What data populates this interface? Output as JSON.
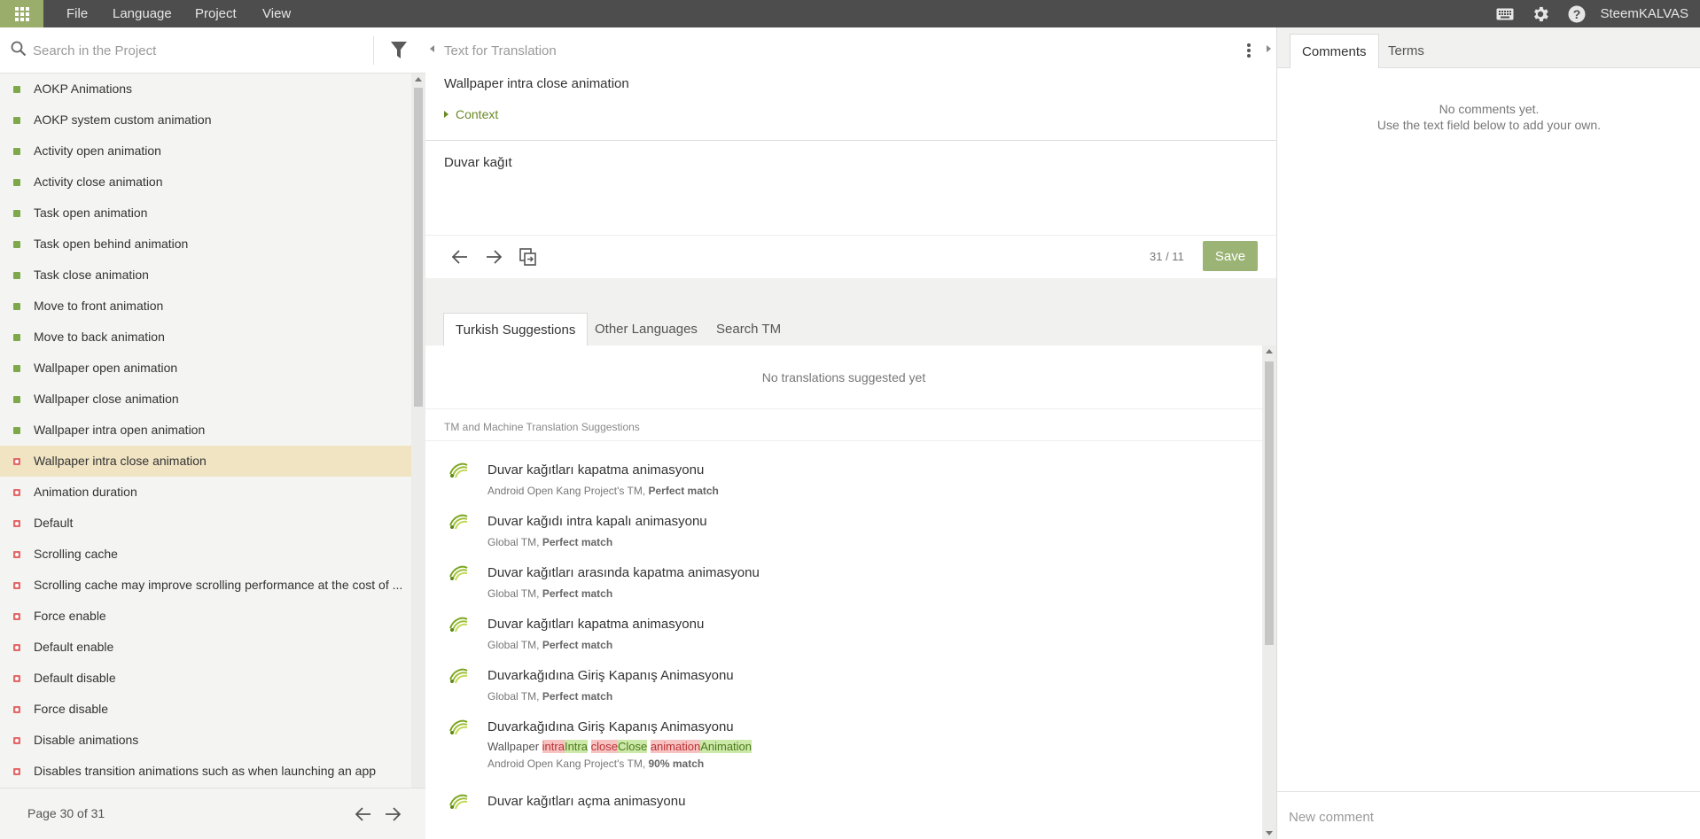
{
  "menu": {
    "items": [
      "File",
      "Language",
      "Project",
      "View"
    ],
    "username": "SteemKALVAS"
  },
  "left": {
    "search_placeholder": "Search in the Project",
    "strings": [
      {
        "label": "AOKP Animations",
        "status": "done"
      },
      {
        "label": "AOKP system custom animation",
        "status": "done"
      },
      {
        "label": "Activity open animation",
        "status": "done"
      },
      {
        "label": "Activity close animation",
        "status": "done"
      },
      {
        "label": "Task open animation",
        "status": "done"
      },
      {
        "label": "Task open behind animation",
        "status": "done"
      },
      {
        "label": "Task close animation",
        "status": "done"
      },
      {
        "label": "Move to front animation",
        "status": "done"
      },
      {
        "label": "Move to back animation",
        "status": "done"
      },
      {
        "label": "Wallpaper open animation",
        "status": "done"
      },
      {
        "label": "Wallpaper close animation",
        "status": "done"
      },
      {
        "label": "Wallpaper intra open animation",
        "status": "done"
      },
      {
        "label": "Wallpaper intra close animation",
        "status": "todo",
        "selected": true
      },
      {
        "label": "Animation duration",
        "status": "todo"
      },
      {
        "label": "Default",
        "status": "todo"
      },
      {
        "label": "Scrolling cache",
        "status": "todo"
      },
      {
        "label": "Scrolling cache may improve scrolling performance at the cost of ...",
        "status": "todo"
      },
      {
        "label": "Force enable",
        "status": "todo"
      },
      {
        "label": "Default enable",
        "status": "todo"
      },
      {
        "label": "Default disable",
        "status": "todo"
      },
      {
        "label": "Force disable",
        "status": "todo"
      },
      {
        "label": "Disable animations",
        "status": "todo"
      },
      {
        "label": "Disables transition animations such as when launching an app",
        "status": "todo"
      }
    ],
    "page_label": "Page 30 of 31"
  },
  "editor": {
    "header": "Text for Translation",
    "source_text": "Wallpaper intra close animation",
    "context_label": "Context",
    "translation": "Duvar kağıt",
    "counter": "31 / 11",
    "save_label": "Save"
  },
  "suggestions": {
    "tabs": [
      "Turkish Suggestions",
      "Other Languages",
      "Search TM"
    ],
    "empty_text": "No translations suggested yet",
    "tm_header": "TM and Machine Translation Suggestions",
    "items": [
      {
        "text": "Duvar kağıtları kapatma animasyonu",
        "source": "Android Open Kang Project's TM, ",
        "match": "Perfect match"
      },
      {
        "text": "Duvar kağıdı intra kapalı animasyonu",
        "source": "Global TM, ",
        "match": "Perfect match"
      },
      {
        "text": "Duvar kağıtları arasında kapatma animasyonu",
        "source": "Global TM, ",
        "match": "Perfect match"
      },
      {
        "text": "Duvar kağıtları kapatma animasyonu",
        "source": "Global TM, ",
        "match": "Perfect match"
      },
      {
        "text": "Duvarkağıdına Giriş Kapanış Animasyonu",
        "source": "Global TM, ",
        "match": "Perfect match"
      },
      {
        "text": "Duvarkağıdına Giriş Kapanış Animasyonu",
        "source": "Android Open Kang Project's TM, ",
        "match": "90% match",
        "diff": [
          {
            "t": "Wallpaper ",
            "k": "plain"
          },
          {
            "t": "intra",
            "k": "del"
          },
          {
            "t": "Intra",
            "k": "ins"
          },
          {
            "t": " ",
            "k": "plain"
          },
          {
            "t": "close",
            "k": "del"
          },
          {
            "t": "Close",
            "k": "ins"
          },
          {
            "t": " ",
            "k": "plain"
          },
          {
            "t": "animation",
            "k": "del"
          },
          {
            "t": "Animation",
            "k": "ins"
          }
        ]
      },
      {
        "text": "Duvar kağıtları açma animasyonu",
        "source": "",
        "match": ""
      }
    ]
  },
  "comments": {
    "tabs": [
      "Comments",
      "Terms"
    ],
    "empty_line1": "No comments yet.",
    "empty_line2": "Use the text field below to add your own.",
    "input_placeholder": "New comment"
  },
  "colors": {
    "accent": "#9bb475",
    "done": "#7ea94a",
    "todo": "#e46a6a",
    "selected_row": "#f1e4c3",
    "topbar": "#4d4d4d"
  }
}
